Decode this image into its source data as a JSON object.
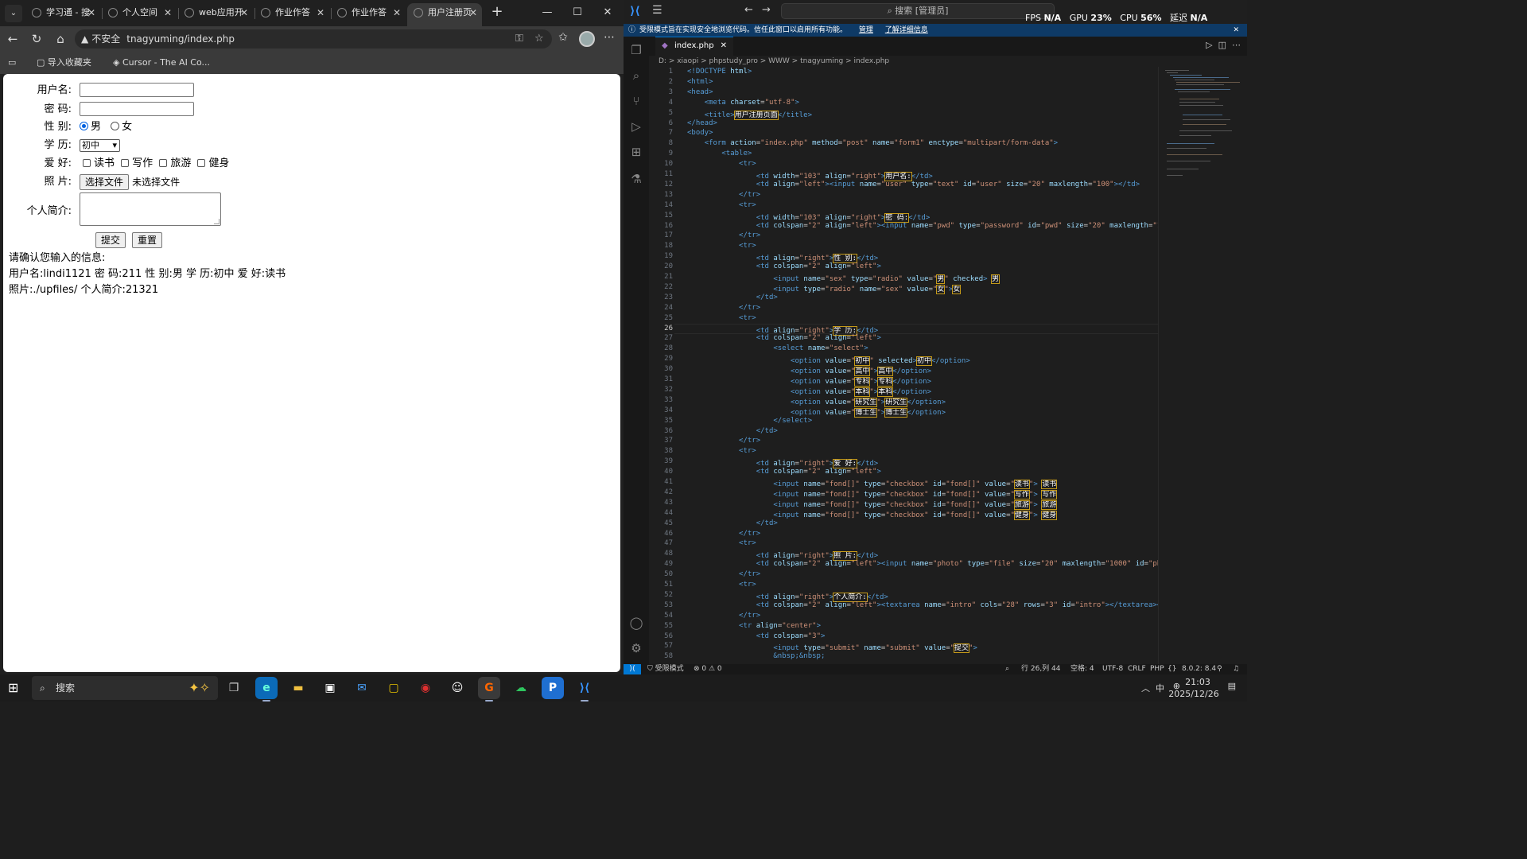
{
  "browser": {
    "tabs": [
      {
        "label": "学习通 - 搜"
      },
      {
        "label": "个人空间"
      },
      {
        "label": "web应用开"
      },
      {
        "label": "作业作答"
      },
      {
        "label": "作业作答"
      },
      {
        "label": "用户注册页"
      }
    ],
    "address": {
      "warning": "不安全",
      "url": "tnagyuming/index.php"
    },
    "bookmarks": [
      {
        "label": "导入收藏夹"
      },
      {
        "label": "Cursor - The AI Co..."
      }
    ]
  },
  "form": {
    "labels": {
      "username": "用户名:",
      "password": "密 码:",
      "gender": "性 别:",
      "education": "学 历:",
      "hobbies": "爱 好:",
      "photo": "照 片:",
      "intro": "个人简介:"
    },
    "gender_options": [
      "男",
      "女"
    ],
    "education_selected": "初中",
    "hobby_options": [
      "读书",
      "写作",
      "旅游",
      "健身"
    ],
    "file_button": "选择文件",
    "file_status": "未选择文件",
    "submit": "提交",
    "reset": "重置"
  },
  "result": {
    "heading": "请确认您输入的信息:",
    "line1": "用户名:lindi1121 密 码:211 性 别:男 学 历:初中 爱 好:读书",
    "line2": "照片:./upfiles/ 个人简介:21321"
  },
  "vscode": {
    "search_placeholder": "搜索 [管理员]",
    "stats": {
      "fps_label": "FPS",
      "fps": "N/A",
      "gpu_label": "GPU",
      "gpu": "23%",
      "cpu_label": "CPU",
      "cpu": "56%",
      "latency_label": "延迟",
      "latency": "N/A"
    },
    "banner": {
      "text": "受限模式旨在实现安全地浏览代码。信任此窗口以启用所有功能。",
      "manage": "管理",
      "learn": "了解详细信息"
    },
    "tab": "index.php",
    "breadcrumb": "D: > xiaopi > phpstudy_pro > WWW > tnagyuming > index.php",
    "current_line": 26,
    "statusbar": {
      "restricted": "受限模式",
      "problems": "⊗ 0 ⚠ 0",
      "position": "行 26,列 44",
      "spaces": "空格: 4",
      "encoding": "UTF-8",
      "eol": "CRLF",
      "language": "PHP",
      "php_version": "8.0.2: 8.4"
    }
  },
  "taskbar": {
    "search": "搜索",
    "time": "21:03",
    "date": "2025/12/26",
    "ime": "中"
  }
}
